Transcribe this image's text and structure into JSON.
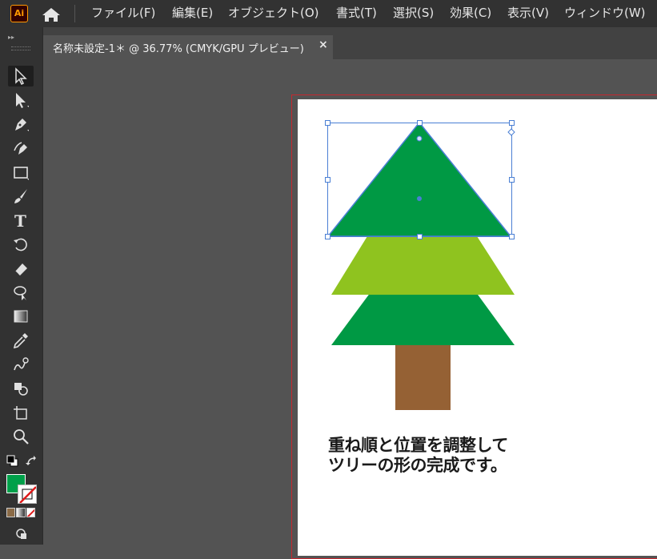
{
  "app": {
    "logo": "Ai"
  },
  "menu": {
    "items": [
      "ファイル(F)",
      "編集(E)",
      "オブジェクト(O)",
      "書式(T)",
      "選択(S)",
      "効果(C)",
      "表示(V)",
      "ウィンドウ(W)"
    ]
  },
  "document": {
    "tab_title": "名称未設定-1＊ @ 36.77% (CMYK/GPU プレビュー)",
    "close": "×"
  },
  "toolbar": {
    "tools": [
      "selection-tool",
      "direct-selection-tool",
      "pen-tool",
      "curvature-tool",
      "rectangle-tool",
      "paintbrush-tool",
      "type-tool",
      "rotate-tool",
      "eraser-tool",
      "lasso-tool",
      "gradient-tool",
      "eyedropper-tool",
      "blend-tool",
      "shape-builder-tool",
      "artboard-tool",
      "zoom-tool"
    ],
    "fill_color": "#00a04a",
    "stroke_color": "none"
  },
  "artwork": {
    "colors": {
      "tree_dark": "#009944",
      "tree_light": "#8fc31f",
      "trunk": "#956134",
      "selection": "#4a7fd4"
    },
    "note_lines": [
      "重ね順と位置を調整して",
      "ツリーの形の完成です。"
    ]
  }
}
